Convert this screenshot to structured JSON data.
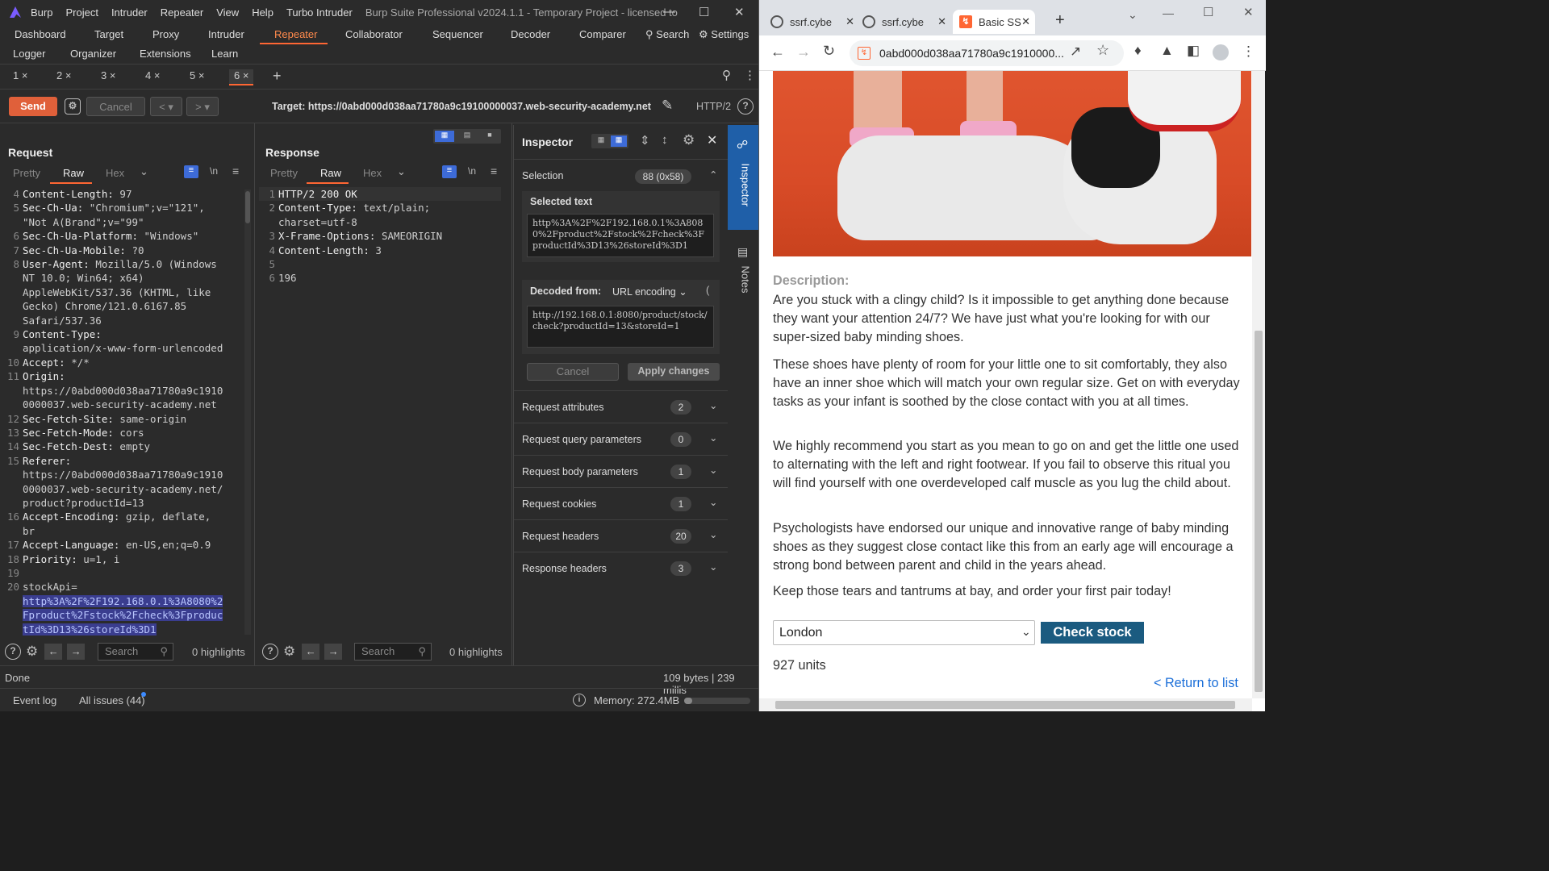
{
  "burp": {
    "title": "Burp Suite Professional v2024.1.1 - Temporary Project - licensed to",
    "menu": [
      "Burp",
      "Project",
      "Intruder",
      "Repeater",
      "View",
      "Help",
      "Turbo Intruder"
    ],
    "tabs_row1": [
      "Dashboard",
      "Target",
      "Proxy",
      "Intruder",
      "Repeater",
      "Collaborator",
      "Sequencer",
      "Decoder",
      "Comparer"
    ],
    "search_label": "Search",
    "settings_label": "Settings",
    "tabs_row2": [
      "Logger",
      "Organizer",
      "Extensions",
      "Learn"
    ],
    "repeater_tabs": [
      "1 ×",
      "2 ×",
      "3 ×",
      "4 ×",
      "5 ×",
      "6 ×"
    ],
    "add_tab": "+",
    "send_label": "Send",
    "cancel_label": "Cancel",
    "target_label": "Target: https://0abd000d038aa71780a9c19100000037.web-security-academy.net",
    "protocol": "HTTP/2",
    "request": {
      "title": "Request",
      "tabs": [
        "Pretty",
        "Raw",
        "Hex"
      ],
      "lines": [
        {
          "n": "4",
          "h": "Content-Length:",
          "v": " 97"
        },
        {
          "n": "5",
          "h": "Sec-Ch-Ua:",
          "v": " \"Chromium\";v=\"121\","
        },
        {
          "n": "",
          "h": "",
          "v": "\"Not A(Brand\";v=\"99\""
        },
        {
          "n": "6",
          "h": "Sec-Ch-Ua-Platform:",
          "v": " \"Windows\""
        },
        {
          "n": "7",
          "h": "Sec-Ch-Ua-Mobile:",
          "v": " ?0"
        },
        {
          "n": "8",
          "h": "User-Agent:",
          "v": " Mozilla/5.0 (Windows"
        },
        {
          "n": "",
          "h": "",
          "v": "NT 10.0; Win64; x64)"
        },
        {
          "n": "",
          "h": "",
          "v": "AppleWebKit/537.36 (KHTML, like"
        },
        {
          "n": "",
          "h": "",
          "v": "Gecko) Chrome/121.0.6167.85"
        },
        {
          "n": "",
          "h": "",
          "v": "Safari/537.36"
        },
        {
          "n": "9",
          "h": "Content-Type:",
          "v": ""
        },
        {
          "n": "",
          "h": "",
          "v": "application/x-www-form-urlencoded"
        },
        {
          "n": "10",
          "h": "Accept:",
          "v": " */*"
        },
        {
          "n": "11",
          "h": "Origin:",
          "v": ""
        },
        {
          "n": "",
          "h": "",
          "v": "https://0abd000d038aa71780a9c1910"
        },
        {
          "n": "",
          "h": "",
          "v": "0000037.web-security-academy.net"
        },
        {
          "n": "12",
          "h": "Sec-Fetch-Site:",
          "v": " same-origin"
        },
        {
          "n": "13",
          "h": "Sec-Fetch-Mode:",
          "v": " cors"
        },
        {
          "n": "14",
          "h": "Sec-Fetch-Dest:",
          "v": " empty"
        },
        {
          "n": "15",
          "h": "Referer:",
          "v": ""
        },
        {
          "n": "",
          "h": "",
          "v": "https://0abd000d038aa71780a9c1910"
        },
        {
          "n": "",
          "h": "",
          "v": "0000037.web-security-academy.net/"
        },
        {
          "n": "",
          "h": "",
          "v": "product?productId=13"
        },
        {
          "n": "16",
          "h": "Accept-Encoding:",
          "v": " gzip, deflate,"
        },
        {
          "n": "",
          "h": "",
          "v": "br"
        },
        {
          "n": "17",
          "h": "Accept-Language:",
          "v": " en-US,en;q=0.9"
        },
        {
          "n": "18",
          "h": "Priority:",
          "v": " u=1, i"
        },
        {
          "n": "19",
          "h": "",
          "v": ""
        },
        {
          "n": "20",
          "h": "",
          "v": "stockApi="
        }
      ],
      "selected_lines": [
        "http%3A%2F%2F192.168.0.1%3A8080%2",
        "Fproduct%2Fstock%2Fcheck%3Fproduc",
        "tId%3D13%26storeId%3D1"
      ],
      "search_placeholder": "Search",
      "highlights": "0 highlights"
    },
    "response": {
      "title": "Response",
      "tabs": [
        "Pretty",
        "Raw",
        "Hex"
      ],
      "lines": [
        {
          "n": "1",
          "h": "HTTP/2 200 OK",
          "v": ""
        },
        {
          "n": "2",
          "h": "Content-Type:",
          "v": " text/plain;"
        },
        {
          "n": "",
          "h": "",
          "v": "charset=utf-8"
        },
        {
          "n": "3",
          "h": "X-Frame-Options:",
          "v": " SAMEORIGIN"
        },
        {
          "n": "4",
          "h": "Content-Length:",
          "v": " 3"
        },
        {
          "n": "5",
          "h": "",
          "v": ""
        },
        {
          "n": "6",
          "h": "",
          "v": "196"
        }
      ],
      "search_placeholder": "Search",
      "highlights": "0 highlights"
    },
    "inspector": {
      "title": "Inspector",
      "selection_label": "Selection",
      "selection_badge": "88 (0x58)",
      "selected_text_label": "Selected text",
      "selected_text": "http%3A%2F%2F192.168.0.1%3A8080%2Fproduct%2Fstock%2Fcheck%3FproductId%3D13%26storeId%3D1",
      "decoded_from_label": "Decoded from:",
      "decoded_from_value": "URL encoding",
      "decoded_text": "http://192.168.0.1:8080/product/stock/check?productId=13&storeId=1",
      "cancel_label": "Cancel",
      "apply_label": "Apply changes",
      "sections": [
        {
          "label": "Request attributes",
          "count": "2"
        },
        {
          "label": "Request query parameters",
          "count": "0"
        },
        {
          "label": "Request body parameters",
          "count": "1"
        },
        {
          "label": "Request cookies",
          "count": "1"
        },
        {
          "label": "Request headers",
          "count": "20"
        },
        {
          "label": "Response headers",
          "count": "3"
        }
      ]
    },
    "side_tabs": [
      "Inspector",
      "Notes"
    ],
    "status_done": "Done",
    "status_bytes": "109 bytes | 239 millis",
    "event_log": "Event log",
    "all_issues": "All issues (44)",
    "memory": "Memory: 272.4MB"
  },
  "chrome": {
    "tabs": [
      {
        "label": "ssrf.cybe"
      },
      {
        "label": "ssrf.cybe"
      },
      {
        "label": "Basic SS"
      }
    ],
    "new_tab": "+",
    "address": "0abd000d038aa71780a9c1910000...",
    "description_label": "Description:",
    "paragraphs": [
      "Are you stuck with a clingy child? Is it impossible to get anything done because they want your attention 24/7? We have just what you're looking for with our super-sized baby minding shoes.",
      "These shoes have plenty of room for your little one to sit comfortably, they also have an inner shoe which will match your own regular size. Get on with everyday tasks as your infant is soothed by the close contact with you at all times.",
      "We highly recommend you start as you mean to go on and get the little one used to alternating with the left and right footwear. If you fail to observe this ritual you will find yourself with one overdeveloped calf muscle as you lug the child about.",
      "Psychologists have endorsed our unique and innovative range of baby minding shoes as they suggest close contact like this from an early age will encourage a strong bond between parent and child in the years ahead.",
      "Keep those tears and tantrums at bay, and order your first pair today!"
    ],
    "store_select": "London",
    "check_stock_label": "Check stock",
    "stock_result": "927 units",
    "return_link": "< Return to list",
    "accent": "#1b5b80"
  }
}
